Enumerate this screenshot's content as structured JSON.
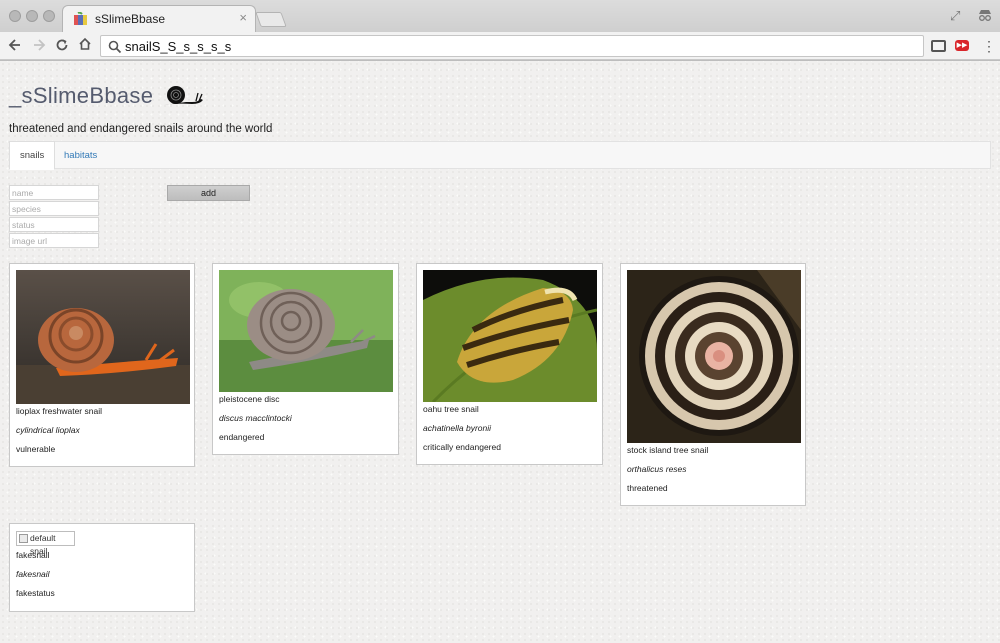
{
  "browser": {
    "tab_title": "sSlimeBbase",
    "tab_close": "×",
    "address": "snailS_S_s_s_s_s",
    "back_icon": "back-arrow-icon",
    "forward_icon": "forward-arrow-icon",
    "reload_icon": "reload-icon",
    "home_icon": "home-icon",
    "extension_label": "▶▶"
  },
  "app": {
    "title": "_sSlimeBbase",
    "tagline": "threatened and endangered snails around the world"
  },
  "nav": {
    "tabs": [
      {
        "label": "snails",
        "active": true
      },
      {
        "label": "habitats",
        "active": false
      }
    ]
  },
  "form": {
    "fields": [
      {
        "placeholder": "name",
        "value": ""
      },
      {
        "placeholder": "species",
        "value": ""
      },
      {
        "placeholder": "status",
        "value": ""
      },
      {
        "placeholder": "image url",
        "value": ""
      }
    ],
    "add_label": "add"
  },
  "snails": [
    {
      "name": "lioplax freshwater snail",
      "species": "cylindrical lioplax",
      "status": "vulnerable"
    },
    {
      "name": "pleistocene disc",
      "species": "discus macclintocki",
      "status": "endangered"
    },
    {
      "name": "oahu tree snail",
      "species": "achatinella byronii",
      "status": "critically endangered"
    },
    {
      "name": "stock island tree snail",
      "species": "orthalicus reses",
      "status": "threatened"
    },
    {
      "name": "fakesnail",
      "species": "fakesnail",
      "status": "fakestatus",
      "image_alt": "default snail"
    }
  ],
  "colors": {
    "link": "#337ab7",
    "brand": "#555b6e"
  }
}
